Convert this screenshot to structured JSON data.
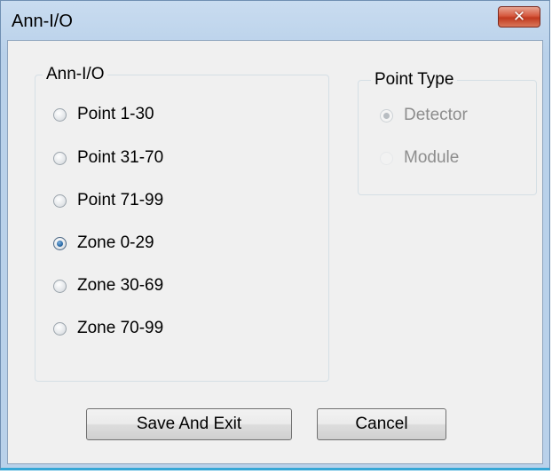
{
  "window": {
    "title": "Ann-I/O",
    "close_symbol": "✕"
  },
  "ann_io_group": {
    "label": "Ann-I/O",
    "options": [
      {
        "label": "Point 1-30",
        "checked": false
      },
      {
        "label": "Point 31-70",
        "checked": false
      },
      {
        "label": "Point 71-99",
        "checked": false
      },
      {
        "label": "Zone 0-29",
        "checked": true
      },
      {
        "label": "Zone 30-69",
        "checked": false
      },
      {
        "label": "Zone 70-99",
        "checked": false
      }
    ]
  },
  "point_type_group": {
    "label": "Point Type",
    "options": [
      {
        "label": "Detector",
        "checked": true,
        "enabled": false
      },
      {
        "label": "Module",
        "checked": false,
        "enabled": false
      }
    ]
  },
  "buttons": {
    "save_label": "Save And Exit",
    "cancel_label": "Cancel"
  },
  "colors": {
    "title_bar": "#b9d1ea",
    "close_button": "#c13a1f",
    "dialog_background": "#f0f0f0",
    "radio_selected": "#1b5c9a"
  }
}
